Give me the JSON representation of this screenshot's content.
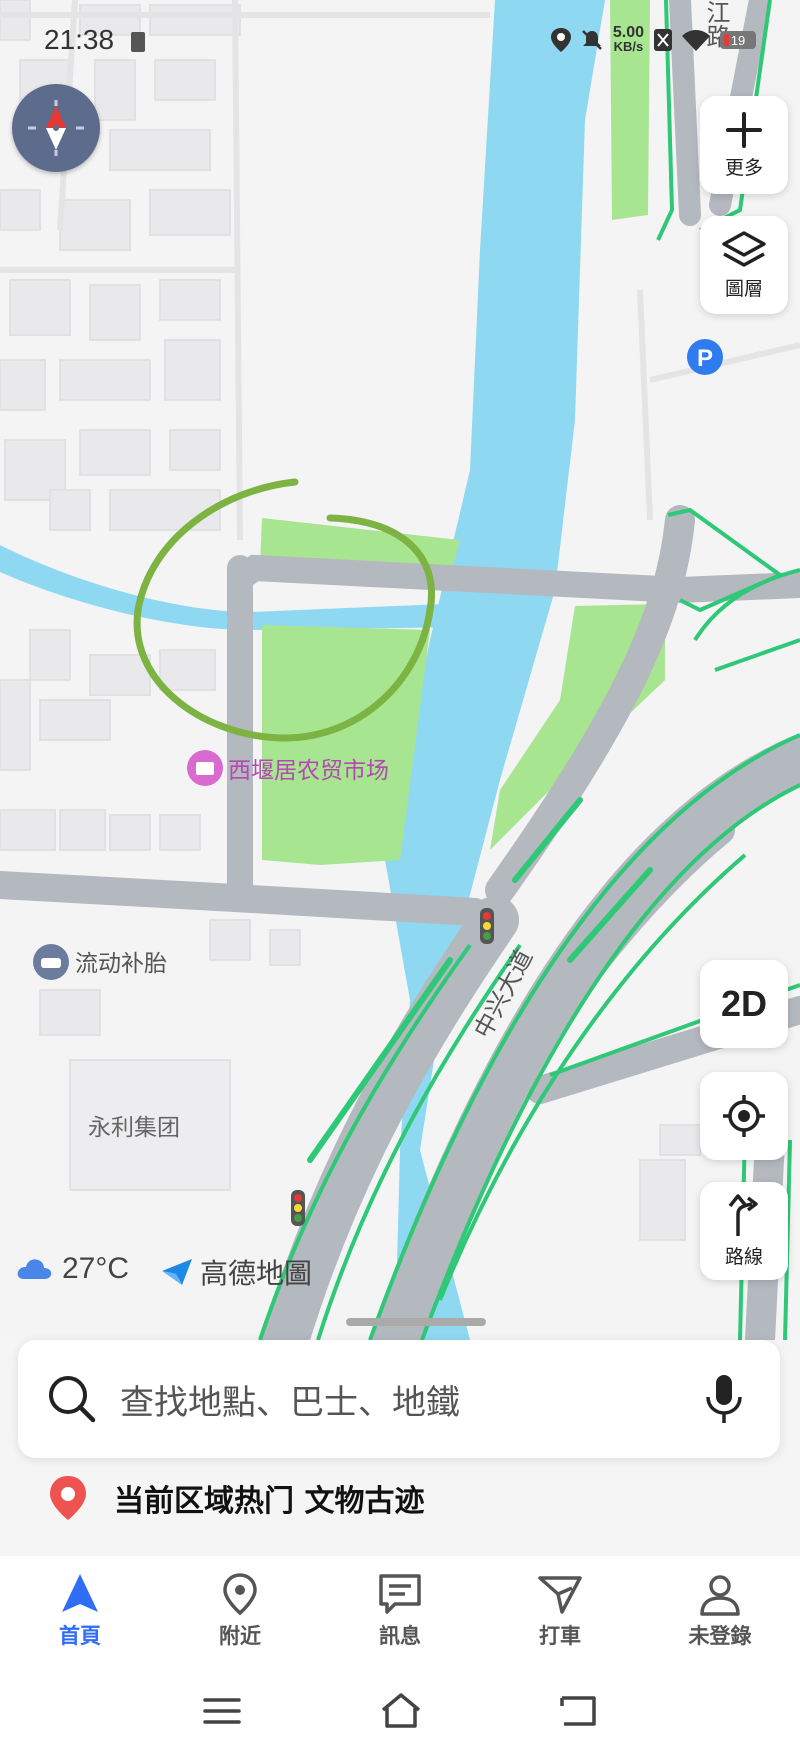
{
  "status_bar": {
    "time": "21:38",
    "net_speed_value": "5.00",
    "net_speed_unit": "KB/s",
    "battery": "19"
  },
  "map": {
    "labels": {
      "market": "西堰居农贸市场",
      "tire": "流动补胎",
      "group": "永利集团",
      "road": "中兴大道",
      "top_road": "江路"
    },
    "icons": [
      "compass-icon",
      "parking-icon",
      "traffic-light-icon",
      "market-poi-icon",
      "car-service-poi-icon"
    ]
  },
  "controls": {
    "more_label": "更多",
    "layers_label": "圖層",
    "mode_label": "2D",
    "route_label": "路線"
  },
  "weather": {
    "temp": "27°C"
  },
  "logo": {
    "text": "高德地圖"
  },
  "search": {
    "placeholder": "查找地點、巴士、地鐵"
  },
  "hot": {
    "text": "当前区域热门 文物古迹"
  },
  "bottom_nav": [
    {
      "label": "首頁",
      "icon": "navigation-arrow-icon",
      "active": true
    },
    {
      "label": "附近",
      "icon": "location-pin-icon",
      "active": false
    },
    {
      "label": "訊息",
      "icon": "message-icon",
      "active": false
    },
    {
      "label": "打車",
      "icon": "taxi-icon",
      "active": false
    },
    {
      "label": "未登錄",
      "icon": "user-icon",
      "active": false
    }
  ],
  "colors": {
    "water": "#8fd8f2",
    "green": "#a8e591",
    "road": "#b4b8bf",
    "road_edge": "#2ec877",
    "accent": "#2f6df6",
    "annotation": "#7cb342"
  }
}
